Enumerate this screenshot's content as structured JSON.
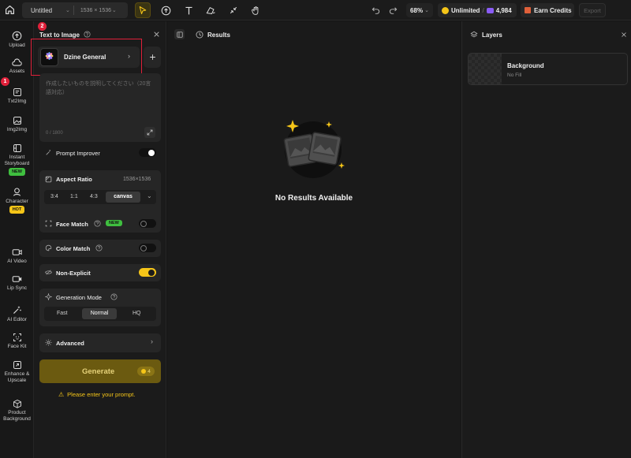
{
  "topbar": {
    "doc_title": "Untitled",
    "doc_size": "1536 × 1536",
    "zoom": "68%",
    "plan": "Unlimited",
    "credits": "4,984",
    "earn_label": "Earn Credits",
    "export_label": "Export"
  },
  "rail": {
    "upload": "Upload",
    "assets": "Assets",
    "txt2img": "Txt2Img",
    "img2img": "Img2Img",
    "storyboard": "Instant Storyboard",
    "storyboard_badge": "NEW",
    "character": "Character",
    "character_badge": "HOT",
    "ai_video": "AI Video",
    "lip_sync": "Lip Sync",
    "ai_editor": "AI Editor",
    "face_kit": "Face Kit",
    "enhance": "Enhance & Upscale",
    "product_bg": "Product Background"
  },
  "annotations": {
    "marker_1": "1",
    "marker_2": "2"
  },
  "panel": {
    "title": "Text to Image",
    "model_name": "Dzine General",
    "prompt_placeholder": "作成したいものを説明してください（20言語対応）",
    "char_count": "0 / 1800",
    "prompt_improver": "Prompt Improver",
    "aspect_ratio_label": "Aspect Ratio",
    "aspect_ratio_value": "1536×1536",
    "ratios": [
      "3:4",
      "1:1",
      "4:3",
      "canvas"
    ],
    "face_match": "Face Match",
    "face_match_badge": "NEW",
    "color_match": "Color Match",
    "non_explicit": "Non-Explicit",
    "generation_mode": "Generation Mode",
    "modes": [
      "Fast",
      "Normal",
      "HQ"
    ],
    "advanced": "Advanced",
    "generate": "Generate",
    "generate_cost": "4",
    "warning": "Please enter your prompt."
  },
  "results": {
    "title": "Results",
    "empty_text": "No Results Available"
  },
  "layers": {
    "title": "Layers",
    "layer_name": "Background",
    "layer_sub": "No Fill"
  },
  "colors": {
    "accent_yellow": "#f5c518",
    "annotation_red": "#e0203a",
    "new_badge": "#3fbf3f",
    "hot_badge": "#f5c518"
  }
}
